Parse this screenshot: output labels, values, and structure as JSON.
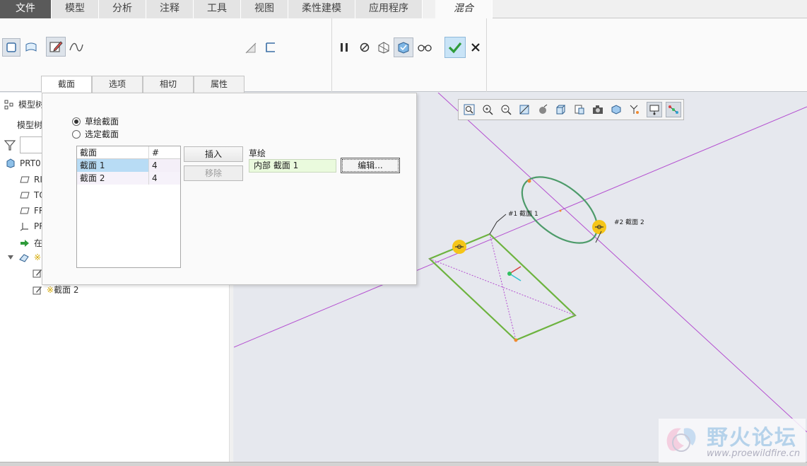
{
  "menubar": {
    "tabs": [
      "文件",
      "模型",
      "分析",
      "注释",
      "工具",
      "视图",
      "柔性建模",
      "应用程序"
    ],
    "active_tab": "混合"
  },
  "dashboard": {
    "subtabs": [
      "截面",
      "选项",
      "相切",
      "属性"
    ]
  },
  "sections_panel": {
    "radio_sketched": "草绘截面",
    "radio_selected": "选定截面",
    "table": {
      "headers": [
        "截面",
        "#"
      ],
      "rows": [
        {
          "name": "截面 1",
          "count": "4"
        },
        {
          "name": "截面 2",
          "count": "4"
        }
      ]
    },
    "insert_button": "插入",
    "remove_button": "移除",
    "sketch_label": "草绘",
    "sketch_value": "内部 截面 1",
    "edit_button": "编辑..."
  },
  "tree": {
    "header_title": "模型树",
    "filter_label": "模型树",
    "items": [
      {
        "label": "PRT0",
        "icon": "part-icon"
      },
      {
        "label": "RI",
        "icon": "datum-plane-icon"
      },
      {
        "label": "TO",
        "icon": "datum-plane-icon"
      },
      {
        "label": "FR",
        "icon": "datum-plane-icon"
      },
      {
        "label": "PR",
        "icon": "coord-system-icon"
      },
      {
        "label": "在",
        "icon": "insert-here-icon"
      },
      {
        "label": "※",
        "icon": "blend-feature-icon"
      },
      {
        "label": "",
        "icon": "sketch-icon"
      },
      {
        "label": "截面 2",
        "icon": "sketch-icon"
      }
    ]
  },
  "graphics": {
    "label_section1": "#1 截面 1",
    "label_section2": "#2 截面 2"
  },
  "watermark": {
    "brand": "野火论坛",
    "url": "www.proewildfire.cn"
  },
  "colors": {
    "sketch_green": "#6db33f",
    "axis_magenta": "#b44fd0",
    "handle_yellow": "#f5c518"
  }
}
